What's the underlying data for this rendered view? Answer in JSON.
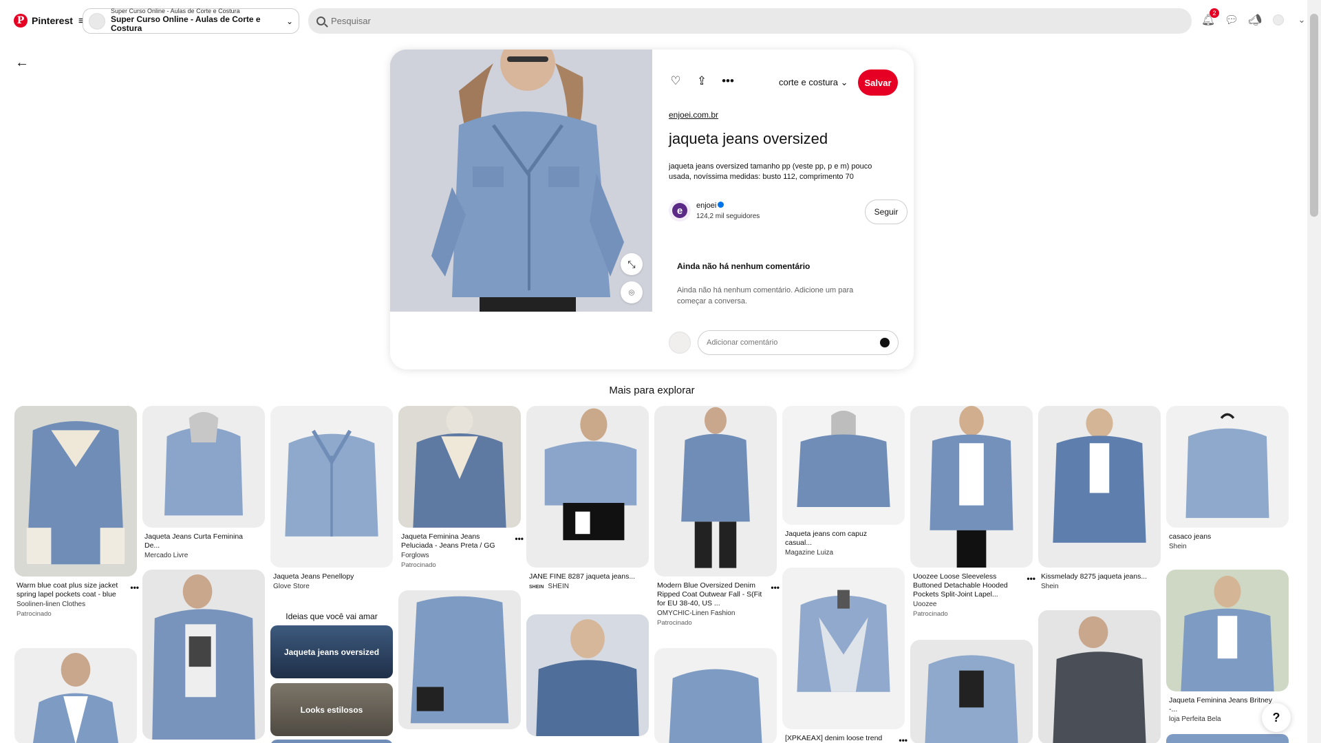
{
  "header": {
    "brand": "Pinterest",
    "board": {
      "sub": "Super Curso Online - Aulas de Corte e Costura",
      "main": "Super Curso Online - Aulas de Corte e Costura"
    },
    "search_placeholder": "Pesquisar",
    "notifications_count": "2"
  },
  "pin": {
    "board_picker": "corte e costura",
    "save_label": "Salvar",
    "source": "enjoei.com.br",
    "title": "jaqueta jeans oversized",
    "description": "jaqueta jeans oversized tamanho pp (veste pp, p e m) pouco usada, novíssima medidas: busto 112, comprimento 70",
    "creator": {
      "name": "enjoei",
      "followers": "124,2 mil seguidores",
      "initial": "e"
    },
    "follow_label": "Seguir",
    "comments_title": "Ainda não há nenhum comentário",
    "comments_empty": "Ainda não há nenhum comentário. Adicione um para começar a conversa.",
    "comment_placeholder": "Adicionar comentário"
  },
  "explore": {
    "title": "Mais para explorar",
    "ideas_title": "Ideias que você vai amar",
    "ideas": [
      "Jaqueta jeans oversized",
      "Looks estilosos"
    ],
    "pins": [
      {
        "name": "Warm blue coat plus size jacket spring lapel pockets coat - blue",
        "by": "Soolinen-linen Clothes",
        "promo": "Patrocinado"
      },
      {
        "name": "Jaqueta Jeans Curta Feminina De...",
        "by": "Mercado Livre"
      },
      {
        "name": "Jaqueta Jeans Penellopy",
        "by": "Glove Store"
      },
      {
        "name": "Jaqueta Feminina Jeans Peluciada - Jeans Preta / GG",
        "by": "Forglows",
        "promo": "Patrocinado"
      },
      {
        "name": "JANE FINE 8287 jaqueta jeans...",
        "by": "SHEIN"
      },
      {
        "name": "Modern Blue Oversized Denim Ripped Coat Outwear Fall - S(Fit for EU 38-40, US ...",
        "by": "OMYCHIC-Linen Fashion",
        "promo": "Patrocinado"
      },
      {
        "name": "Jaqueta jeans com capuz casual...",
        "by": "Magazine Luiza"
      },
      {
        "name": "Uoozee Loose Sleeveless Buttoned Detachable Hooded Pockets Split-Joint Lapel...",
        "by": "Uoozee",
        "promo": "Patrocinado"
      },
      {
        "name": "Kissmelady 8275 jaqueta jeans...",
        "by": "Shein"
      },
      {
        "name": "casaco jeans",
        "by": "Shein"
      },
      {
        "name": "Jaqueta Feminina Jeans Britney -...",
        "by": "loja Perfeita Bela"
      },
      {
        "name": "[XPKAEAX] denim loose trend"
      }
    ],
    "shein_logo": "SHEIN"
  },
  "help_label": "?",
  "colors": {
    "brand": "#e60023",
    "denim": "#7f9cc4",
    "background": "#ffffff"
  },
  "icons": [
    "pinterest-logo-icon",
    "menu-icon",
    "search-icon",
    "bell-icon",
    "chat-icon",
    "megaphone-icon",
    "avatar",
    "chevron-down-icon",
    "back-arrow-icon",
    "heart-icon",
    "share-icon",
    "more-icon",
    "expand-icon",
    "visual-search-icon",
    "emoji-icon",
    "help-icon"
  ]
}
